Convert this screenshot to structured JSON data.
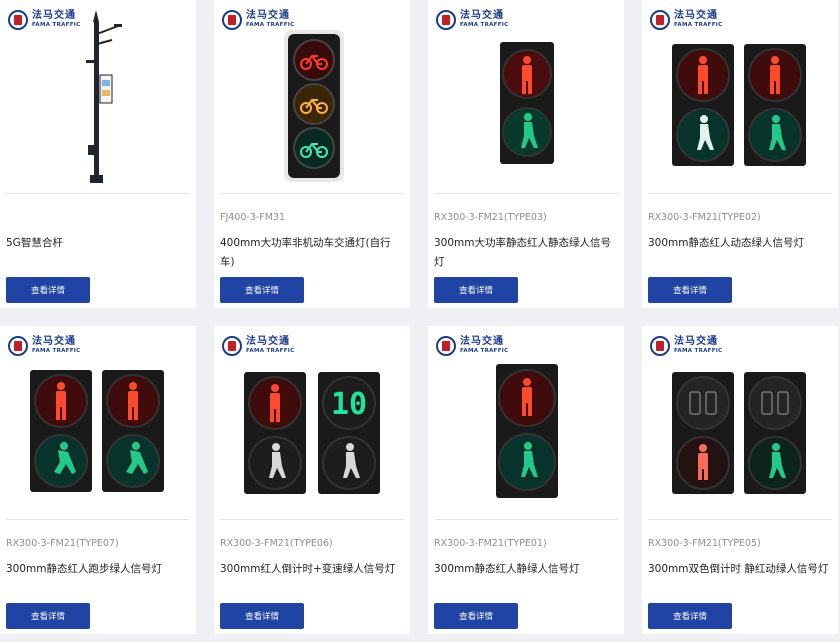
{
  "logo": {
    "cn": "法马交通",
    "en": "FAMA TRAFFIC"
  },
  "button_label": "查看详情",
  "cards": [
    {
      "model": "",
      "title": "5G智慧合杆"
    },
    {
      "model": "FJ400-3-FM31",
      "title": "400mm大功率非机动车交通灯(自行车)"
    },
    {
      "model": "RX300-3-FM21(TYPE03)",
      "title": "300mm大功率静态红人静态绿人信号灯"
    },
    {
      "model": "RX300-3-FM21(TYPE02)",
      "title": "300mm静态红人动态绿人信号灯"
    },
    {
      "model": "RX300-3-FM21(TYPE07)",
      "title": "300mm静态红人跑步绿人信号灯"
    },
    {
      "model": "RX300-3-FM21(TYPE06)",
      "title": "300mm红人倒计时+变速绿人信号灯"
    },
    {
      "model": "RX300-3-FM21(TYPE01)",
      "title": "300mm静态红人静绿人信号灯"
    },
    {
      "model": "RX300-3-FM21(TYPE05)",
      "title": "300mm双色倒计时 静红动绿人信号灯"
    }
  ],
  "countdown_display": {
    "digits": "10"
  },
  "colors": {
    "brand_blue": "#1f44a3",
    "red_lamp": "#e0291c",
    "green_lamp": "#22c98a",
    "amber_lamp": "#f2a21b"
  }
}
